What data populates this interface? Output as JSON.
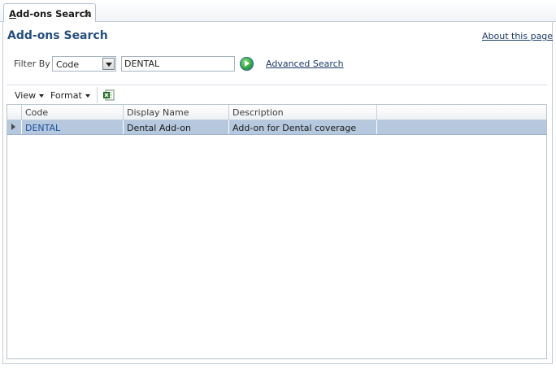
{
  "tabs": [
    {
      "label": "Add-ons Search",
      "close_glyph": "×"
    }
  ],
  "page": {
    "title": "Add-ons Search",
    "about_link": "About this page"
  },
  "filter": {
    "label": "Filter By",
    "field_value": "Code",
    "search_value": "DENTAL",
    "advanced_link": "Advanced Search"
  },
  "toolbar": {
    "view_label": "View",
    "format_label": "Format",
    "export_icon": "excel-export-icon"
  },
  "table": {
    "columns": [
      "Code",
      "Display Name",
      "Description",
      ""
    ],
    "rows": [
      {
        "code": "DENTAL",
        "display_name": "Dental Add-on",
        "description": "Add-on for Dental coverage"
      }
    ]
  },
  "colors": {
    "title": "#27507e",
    "link": "#1c3b6b",
    "selected_row": "#b5c8de"
  }
}
